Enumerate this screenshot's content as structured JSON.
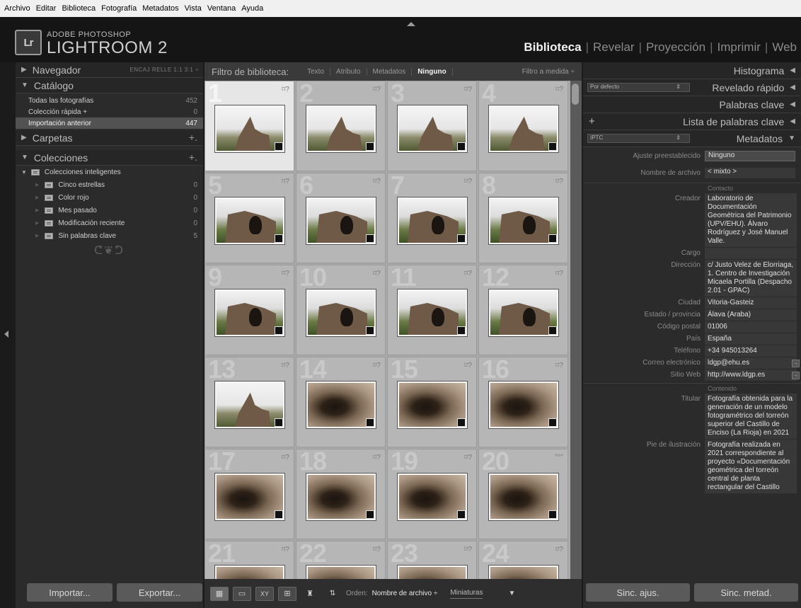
{
  "menu": [
    "Archivo",
    "Editar",
    "Biblioteca",
    "Fotografía",
    "Metadatos",
    "Vista",
    "Ventana",
    "Ayuda"
  ],
  "identity": {
    "logo": "Lr",
    "line1": "ADOBE PHOTOSHOP",
    "line2": "LIGHTROOM 2"
  },
  "modules": [
    "Biblioteca",
    "Revelar",
    "Proyección",
    "Imprimir",
    "Web"
  ],
  "left": {
    "navigator": {
      "title": "Navegador",
      "opts": "ENCAJ  RELLE  1:1  3:1 ÷"
    },
    "catalog": {
      "title": "Catálogo",
      "rows": [
        {
          "label": "Todas las fotografías",
          "count": "452"
        },
        {
          "label": "Colección rápida +",
          "count": "0"
        },
        {
          "label": "Importación anterior",
          "count": "447"
        }
      ]
    },
    "folders": {
      "title": "Carpetas"
    },
    "collections": {
      "title": "Colecciones",
      "group": "Colecciones inteligentes",
      "items": [
        {
          "label": "Cinco estrellas",
          "count": "0"
        },
        {
          "label": "Color rojo",
          "count": "0"
        },
        {
          "label": "Mes pasado",
          "count": "0"
        },
        {
          "label": "Modificación reciente",
          "count": "0"
        },
        {
          "label": "Sin palabras clave",
          "count": "5"
        }
      ]
    },
    "ornament": "ᕦ❦ᕤ",
    "import": "Importar...",
    "export": "Exportar..."
  },
  "filter": {
    "label": "Filtro de biblioteca:",
    "options": [
      "Texto",
      "Atributo",
      "Metadatos",
      "Ninguno"
    ],
    "custom": "Filtro a medida ÷"
  },
  "grid": {
    "cells": [
      {
        "n": "1"
      },
      {
        "n": "2"
      },
      {
        "n": "3"
      },
      {
        "n": "4"
      },
      {
        "n": "5"
      },
      {
        "n": "6"
      },
      {
        "n": "7"
      },
      {
        "n": "8"
      },
      {
        "n": "9"
      },
      {
        "n": "10"
      },
      {
        "n": "11"
      },
      {
        "n": "12"
      },
      {
        "n": "13"
      },
      {
        "n": "14"
      },
      {
        "n": "15"
      },
      {
        "n": "16"
      },
      {
        "n": "17"
      },
      {
        "n": "18"
      },
      {
        "n": "19"
      },
      {
        "n": "20"
      },
      {
        "n": "21"
      },
      {
        "n": "22"
      },
      {
        "n": "23"
      },
      {
        "n": "24"
      }
    ],
    "badge": "⌑?",
    "badge20": "°°°"
  },
  "toolbar": {
    "sortLabel": "Orden:",
    "sortValue": "Nombre de archivo ÷",
    "thumbLabel": "Miniaturas"
  },
  "right": {
    "histogram": "Histograma",
    "quickdev": "Revelado rápido",
    "quickdevPreset": "Por defecto",
    "keywords": "Palabras clave",
    "keywordlist": "Lista de palabras clave",
    "metadata": "Metadatos",
    "metaPreset": "IPTC",
    "presetLabel": "Ajuste preestablecido",
    "presetValue": "Ninguno",
    "filenameLabel": "Nombre de archivo",
    "filenameValue": "< mixto >",
    "contactGroup": "Contacto",
    "contact": [
      {
        "label": "Creador",
        "value": "Laboratorio de Documentación Geométrica del Patrimonio (UPV/EHU). Álvaro Rodríguez y José Manuel Valle."
      },
      {
        "label": "Cargo",
        "value": ""
      },
      {
        "label": "Dirección",
        "value": "c/ Justo Velez de Elorriaga, 1. Centro de Investigación Micaela Portilla (Despacho 2.01 - GPAC)"
      },
      {
        "label": "Ciudad",
        "value": "Vitoria-Gasteiz"
      },
      {
        "label": "Estado / provincia",
        "value": "Álava (Araba)"
      },
      {
        "label": "Código postal",
        "value": "01006"
      },
      {
        "label": "País",
        "value": "España"
      },
      {
        "label": "Teléfono",
        "value": "+34 945013264"
      },
      {
        "label": "Correo electrónico",
        "value": "ldgp@ehu.es"
      },
      {
        "label": "Sitio Web",
        "value": "http://www.ldgp.es"
      }
    ],
    "contentGroup": "Contenido",
    "content": [
      {
        "label": "Titular",
        "value": "Fotografía obtenida para la generación de un modelo fotogramétrico del torreón superior del Castillo de Enciso (La Rioja) en 2021"
      },
      {
        "label": "Pie de ilustración",
        "value": "Fotografía realizada en 2021 correspondiente al proyecto «Documentación geométrica del torreón central de planta rectangular del Castillo"
      }
    ],
    "syncSettings": "Sinc. ajus.",
    "syncMeta": "Sinc. metad."
  }
}
